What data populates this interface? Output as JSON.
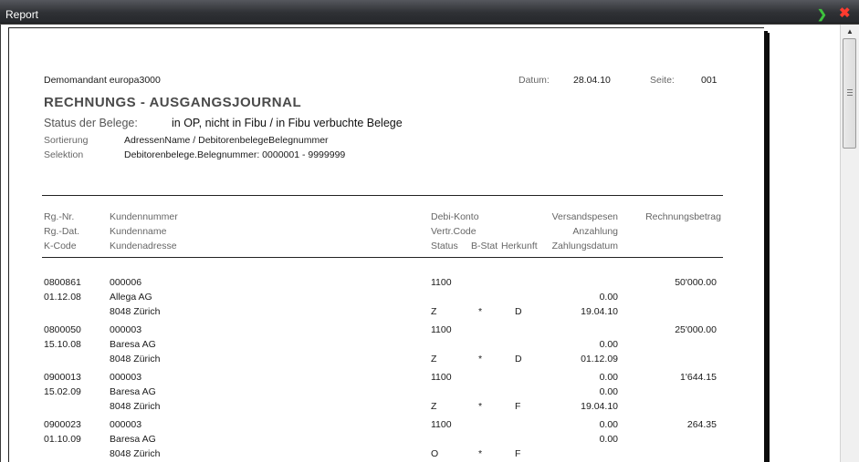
{
  "window": {
    "title": "Report"
  },
  "header": {
    "company": "Demomandant europa3000",
    "date_label": "Datum:",
    "date_value": "28.04.10",
    "page_label": "Seite:",
    "page_value": "001",
    "title": "RECHNUNGS - AUSGANGSJOURNAL",
    "status_label": "Status der Belege:",
    "status_value": "in OP, nicht in Fibu / in Fibu verbuchte Belege",
    "sort_label": "Sortierung",
    "sort_value": "AdressenName / DebitorenbelegeBelegnummer",
    "sel_label": "Selektion",
    "sel_value": "Debitorenbelege.Belegnummer: 0000001 - 9999999"
  },
  "columns": {
    "r1": [
      "Rg.-Nr.",
      "Kundennummer",
      "Debi-Konto",
      "Versandspesen",
      "Rechnungsbetrag"
    ],
    "r2": [
      "Rg.-Dat.",
      "Kundenname",
      "Vertr.Code",
      "Anzahlung"
    ],
    "r3": [
      "K-Code",
      "Kundenadresse",
      "Status",
      "B-Stat",
      "Herkunft",
      "Zahlungsdatum"
    ]
  },
  "rows": [
    {
      "nr": "0800861",
      "knr": "000006",
      "konto": "1100",
      "spesen": "",
      "betrag": "50'000.00",
      "dat": "01.12.08",
      "name": "Allega AG",
      "anz": "0.00",
      "kcode": "",
      "adr": "8048 Zürich",
      "status": "Z",
      "bstat": "*",
      "herk": "D",
      "zdat": "19.04.10"
    },
    {
      "nr": "0800050",
      "knr": "000003",
      "konto": "1100",
      "spesen": "",
      "betrag": "25'000.00",
      "dat": "15.10.08",
      "name": "Baresa  AG",
      "anz": "0.00",
      "kcode": "",
      "adr": "8048 Zürich",
      "status": "Z",
      "bstat": "*",
      "herk": "D",
      "zdat": "01.12.09"
    },
    {
      "nr": "0900013",
      "knr": "000003",
      "konto": "1100",
      "spesen": "0.00",
      "betrag": "1'644.15",
      "dat": "15.02.09",
      "name": "Baresa  AG",
      "anz": "0.00",
      "kcode": "",
      "adr": "8048 Zürich",
      "status": "Z",
      "bstat": "*",
      "herk": "F",
      "zdat": "19.04.10"
    },
    {
      "nr": "0900023",
      "knr": "000003",
      "konto": "1100",
      "spesen": "0.00",
      "betrag": "264.35",
      "dat": "01.10.09",
      "name": "Baresa  AG",
      "anz": "0.00",
      "kcode": "",
      "adr": "8048 Zürich",
      "status": "O",
      "bstat": "*",
      "herk": "F",
      "zdat": ""
    }
  ]
}
